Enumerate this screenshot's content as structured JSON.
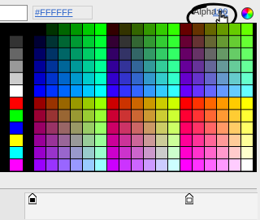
{
  "header": {
    "hex_value": "#FFFFFF",
    "alpha_label": "Alpha:%",
    "alpha_value": "100",
    "preview_color": "#FFFFFF"
  },
  "icons": {
    "color_wheel": "color-wheel-icon",
    "cursor": "hand-pointer-icon",
    "gradient_pointer": "gradient-pointer-icon"
  },
  "palette": {
    "left_column": [
      "#000000",
      "#333333",
      "#666666",
      "#999999",
      "#cccccc",
      "#ffffff",
      "#ff0000",
      "#00ff00",
      "#0000ff",
      "#ffff00",
      "#00ffff",
      "#ff00ff"
    ],
    "levels": [
      "00",
      "33",
      "66",
      "99",
      "cc",
      "ff"
    ],
    "rows": 12,
    "cols": 18
  },
  "annotation_color": "#000000",
  "link_color": "#2a62c9"
}
